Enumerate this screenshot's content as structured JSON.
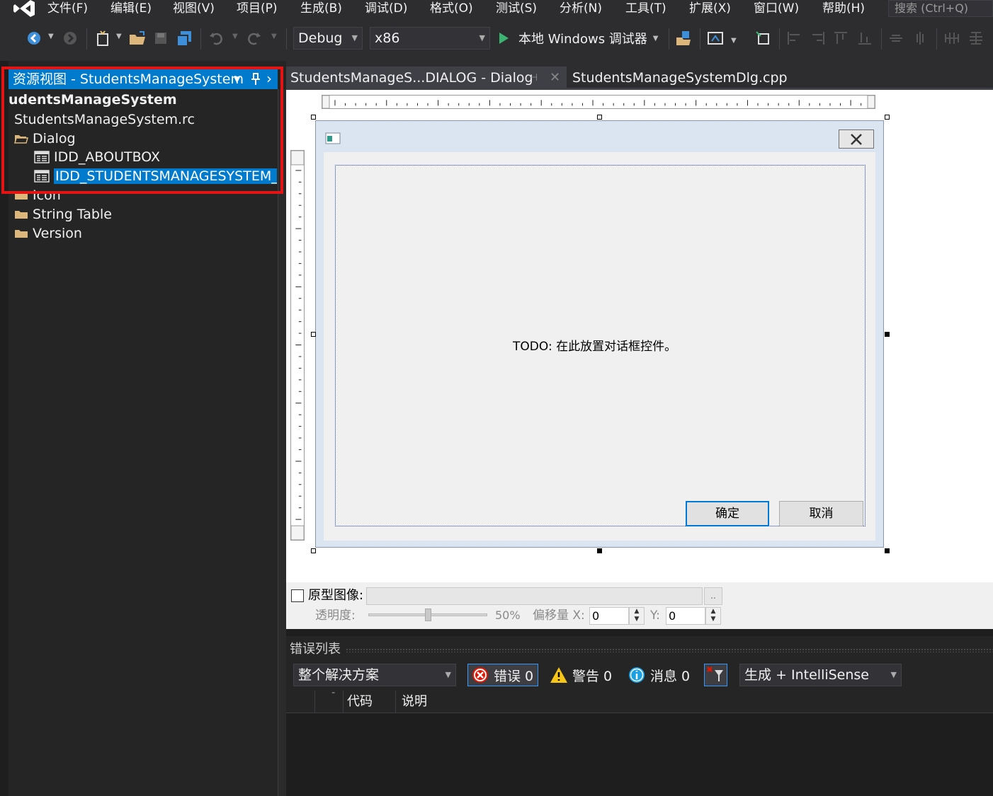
{
  "menu": {
    "items": [
      "文件(F)",
      "编辑(E)",
      "视图(V)",
      "项目(P)",
      "生成(B)",
      "调试(D)",
      "格式(O)",
      "测试(S)",
      "分析(N)",
      "工具(T)",
      "扩展(X)",
      "窗口(W)",
      "帮助(H)"
    ],
    "search_placeholder": "搜索 (Ctrl+Q)"
  },
  "toolbar": {
    "configuration": "Debug",
    "platform": "x86",
    "run_label": "本地 Windows 调试器"
  },
  "resource_view": {
    "header": "资源视图 - StudentsManageSystem",
    "project": "udentsManageSystem",
    "rc_file": "StudentsManageSystem.rc",
    "folders": [
      "Dialog",
      "Icon",
      "String Table",
      "Version"
    ],
    "dialogs": [
      "IDD_ABOUTBOX",
      "IDD_STUDENTSMANAGESYSTEM_DI"
    ]
  },
  "tabs": {
    "active": "StudentsManageS...DIALOG - Dialog",
    "inactive": "StudentsManageSystemDlg.cpp"
  },
  "dialog": {
    "todo_text": "TODO: 在此放置对话框控件。",
    "ok_label": "确定",
    "cancel_label": "取消"
  },
  "prototype": {
    "label": "原型图像:",
    "browse_label": "..",
    "opacity_label": "透明度:",
    "opacity_value": "50%",
    "opacity_fraction": 0.5,
    "offset_label": "偏移量 X:",
    "offset_x": "0",
    "y_label": "Y:",
    "offset_y": "0"
  },
  "error_list": {
    "title": "错误列表",
    "scope": "整个解决方案",
    "errors": "错误 0",
    "warnings": "警告 0",
    "messages": "消息 0",
    "source": "生成 + IntelliSense",
    "col_code": "代码",
    "col_description": "说明"
  },
  "colors": {
    "accent": "#007acc",
    "highlight_box": "#e51414",
    "chrome": "#2d2d30"
  },
  "icons": [
    "vs-logo-icon",
    "back-icon",
    "forward-icon",
    "new-project-icon",
    "open-icon",
    "save-icon",
    "save-all-icon",
    "undo-icon",
    "redo-icon",
    "play-icon",
    "pin-icon",
    "close-icon",
    "folder-icon",
    "dialog-icon",
    "error-icon",
    "warning-icon",
    "info-icon",
    "filter-icon"
  ]
}
